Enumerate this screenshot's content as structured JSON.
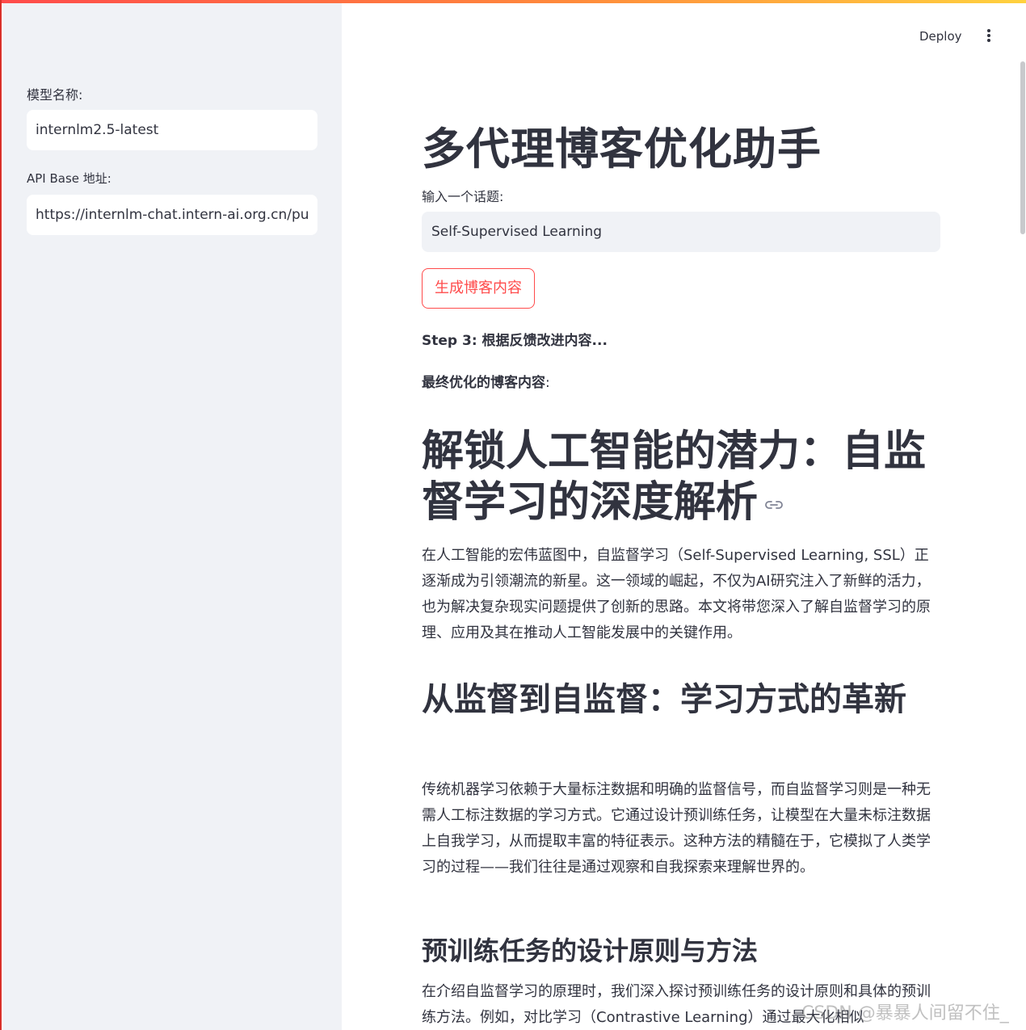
{
  "sidebar": {
    "model_label": "模型名称:",
    "model_value": "internlm2.5-latest",
    "api_label": "API Base 地址:",
    "api_value": "https://internlm-chat.intern-ai.org.cn/pu"
  },
  "header": {
    "deploy_label": "Deploy",
    "menu_icon": "kebab-menu-icon"
  },
  "main": {
    "title": "多代理博客优化助手",
    "topic_label": "输入一个话题:",
    "topic_value": "Self-Supervised Learning",
    "generate_button": "生成博客内容",
    "step_text": "Step 3: 根据反馈改进内容...",
    "final_label_bold": "最终优化的博客内容",
    "final_label_colon": ":",
    "blog": {
      "h1": "解锁人工智能的潜力：自监督学习的深度解析",
      "link_icon": "link-icon",
      "p1": "在人工智能的宏伟蓝图中，自监督学习（Self-Supervised Learning, SSL）正逐渐成为引领潮流的新星。这一领域的崛起，不仅为AI研究注入了新鲜的活力，也为解决复杂现实问题提供了创新的思路。本文将带您深入了解自监督学习的原理、应用及其在推动人工智能发展中的关键作用。",
      "h2": "从监督到自监督：学习方式的革新",
      "p2": "传统机器学习依赖于大量标注数据和明确的监督信号，而自监督学习则是一种无需人工标注数据的学习方式。它通过设计预训练任务，让模型在大量未标注数据上自我学习，从而提取丰富的特征表示。这种方法的精髓在于，它模拟了人类学习的过程——我们往往是通过观察和自我探索来理解世界的。",
      "h3": "预训练任务的设计原则与方法",
      "p3": "在介绍自监督学习的原理时，我们深入探讨预训练任务的设计原则和具体的预训练方法。例如，对比学习（Contrastive Learning）通过最大化相似"
    }
  },
  "watermark": "CSDN @暴暴人间留不住_",
  "colors": {
    "accent": "#ff4b4b",
    "sidebar_bg": "#f0f2f6",
    "text": "#31333f"
  }
}
